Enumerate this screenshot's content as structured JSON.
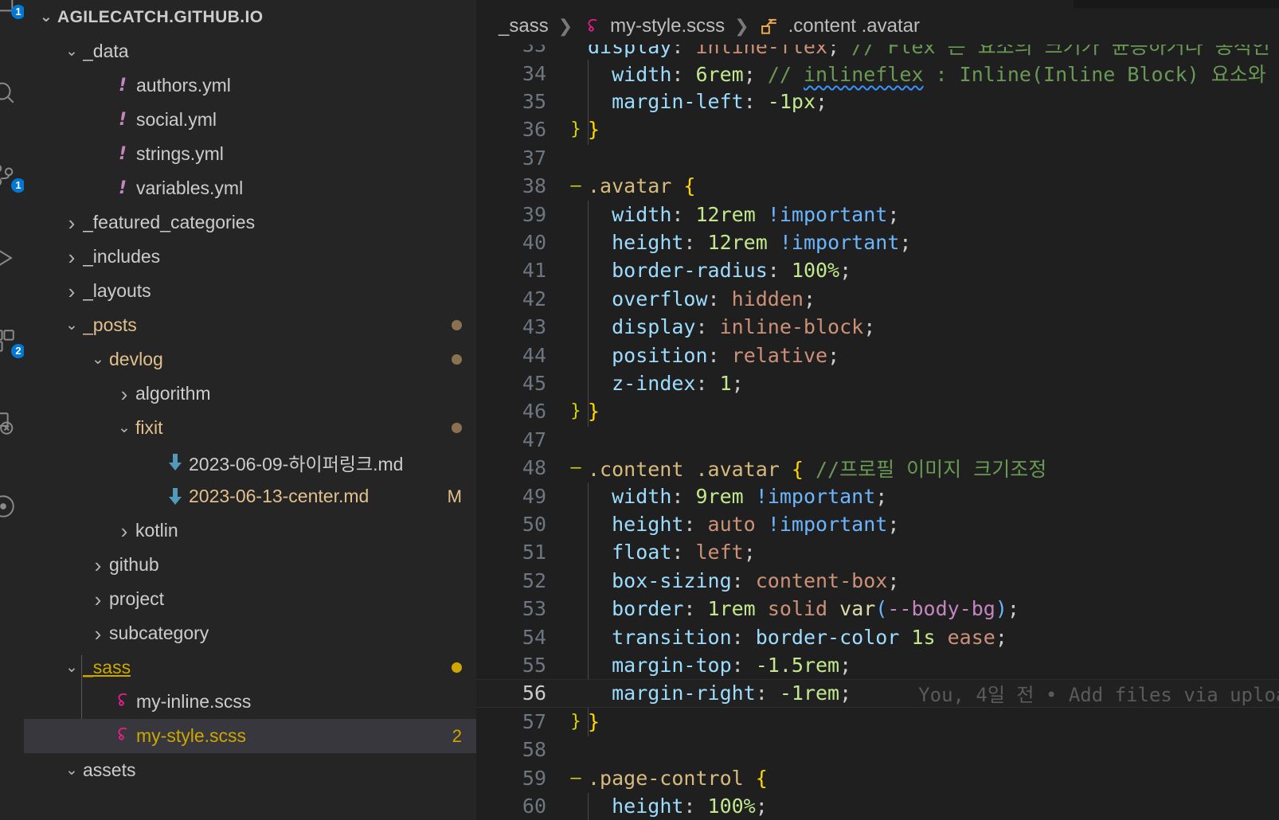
{
  "activity_bar": {
    "items": [
      {
        "name": "explorer-icon",
        "badge": "1"
      },
      {
        "name": "search-icon",
        "badge": null
      },
      {
        "name": "source-control-icon",
        "badge": "1"
      },
      {
        "name": "run-and-debug-icon",
        "badge": null
      },
      {
        "name": "extensions-icon",
        "badge": "2"
      },
      {
        "name": "remote-explorer-icon",
        "badge": null
      },
      {
        "name": "testing-icon",
        "badge": null
      }
    ]
  },
  "explorer": {
    "root_label": "AGILECATCH.GITHUB.IO",
    "tree": [
      {
        "label": "_data",
        "kind": "folder",
        "depth": 1,
        "expanded": true
      },
      {
        "label": "authors.yml",
        "kind": "yml",
        "depth": 2
      },
      {
        "label": "social.yml",
        "kind": "yml",
        "depth": 2
      },
      {
        "label": "strings.yml",
        "kind": "yml",
        "depth": 2
      },
      {
        "label": "variables.yml",
        "kind": "yml",
        "depth": 2
      },
      {
        "label": "_featured_categories",
        "kind": "folder",
        "depth": 1,
        "expanded": false
      },
      {
        "label": "_includes",
        "kind": "folder",
        "depth": 1,
        "expanded": false
      },
      {
        "label": "_layouts",
        "kind": "folder",
        "depth": 1,
        "expanded": false
      },
      {
        "label": "_posts",
        "kind": "folder",
        "depth": 1,
        "expanded": true,
        "git_status": "modified-child",
        "dot": true
      },
      {
        "label": "devlog",
        "kind": "folder",
        "depth": 2,
        "expanded": true,
        "git_status": "modified-child",
        "dot": true
      },
      {
        "label": "algorithm",
        "kind": "folder",
        "depth": 3,
        "expanded": false
      },
      {
        "label": "fixit",
        "kind": "folder",
        "depth": 3,
        "expanded": true,
        "git_status": "modified-child",
        "dot": true
      },
      {
        "label": "2023-06-09-하이퍼링크.md",
        "kind": "md",
        "depth": 4
      },
      {
        "label": "2023-06-13-center.md",
        "kind": "md",
        "depth": 4,
        "git_status": "modified",
        "badge": "M"
      },
      {
        "label": "kotlin",
        "kind": "folder",
        "depth": 3,
        "expanded": false
      },
      {
        "label": "github",
        "kind": "folder",
        "depth": 2,
        "expanded": false
      },
      {
        "label": "project",
        "kind": "folder",
        "depth": 2,
        "expanded": false
      },
      {
        "label": "subcategory",
        "kind": "folder",
        "depth": 2,
        "expanded": false
      },
      {
        "label": "_sass",
        "kind": "folder",
        "depth": 1,
        "expanded": true,
        "git_status": "modified-child-strong",
        "dot": true
      },
      {
        "label": "my-inline.scss",
        "kind": "scss",
        "depth": 2
      },
      {
        "label": "my-style.scss",
        "kind": "scss",
        "depth": 2,
        "selected": true,
        "git_status": "problems",
        "badge": "2"
      },
      {
        "label": "assets",
        "kind": "folder",
        "depth": 1,
        "expanded": true
      }
    ]
  },
  "breadcrumb": {
    "folder": "_sass",
    "file": "my-style.scss",
    "symbol": ".content .avatar",
    "separator": "❯"
  },
  "editor": {
    "active_line": 56,
    "blame": "You, 4일 전 • Add files via uploa",
    "lines": [
      {
        "n": 33,
        "clipped_top": true,
        "fold": "",
        "tokens": [
          {
            "t": "display",
            "c": "t-prop"
          },
          {
            "t": ": ",
            "c": "t-punc"
          },
          {
            "t": "inline-flex",
            "c": "t-val"
          },
          {
            "t": ";",
            "c": "t-punc"
          },
          {
            "t": " // Flex 은 요소의 크기가 균등하거나 동적인",
            "c": "t-com"
          }
        ]
      },
      {
        "n": 34,
        "fold": "",
        "tokens": [
          {
            "t": "  ",
            "c": "t-punc"
          },
          {
            "t": "width",
            "c": "t-prop"
          },
          {
            "t": ": ",
            "c": "t-punc"
          },
          {
            "t": "6rem",
            "c": "t-num"
          },
          {
            "t": ";",
            "c": "t-punc"
          },
          {
            "t": " // ",
            "c": "t-com"
          },
          {
            "t": "inlineflex",
            "c": "t-com squiggle"
          },
          {
            "t": " : Inline(Inline Block) 요소와 같은",
            "c": "t-com"
          }
        ]
      },
      {
        "n": 35,
        "fold": "",
        "tokens": [
          {
            "t": "  ",
            "c": "t-punc"
          },
          {
            "t": "margin-left",
            "c": "t-prop"
          },
          {
            "t": ": ",
            "c": "t-punc"
          },
          {
            "t": "-1px",
            "c": "t-num"
          },
          {
            "t": ";",
            "c": "t-punc"
          }
        ]
      },
      {
        "n": 36,
        "fold": "}",
        "tokens": [
          {
            "t": "}",
            "c": "t-brace"
          }
        ]
      },
      {
        "n": 37,
        "fold": "",
        "tokens": []
      },
      {
        "n": 38,
        "fold": "-",
        "tokens": [
          {
            "t": ".avatar",
            "c": "t-sel"
          },
          {
            "t": " ",
            "c": "t-punc"
          },
          {
            "t": "{",
            "c": "t-brace"
          }
        ]
      },
      {
        "n": 39,
        "fold": "",
        "tokens": [
          {
            "t": "  ",
            "c": "t-punc"
          },
          {
            "t": "width",
            "c": "t-prop"
          },
          {
            "t": ": ",
            "c": "t-punc"
          },
          {
            "t": "12rem",
            "c": "t-num"
          },
          {
            "t": " ",
            "c": "t-punc"
          },
          {
            "t": "!important",
            "c": "t-kw"
          },
          {
            "t": ";",
            "c": "t-punc"
          }
        ]
      },
      {
        "n": 40,
        "fold": "",
        "tokens": [
          {
            "t": "  ",
            "c": "t-punc"
          },
          {
            "t": "height",
            "c": "t-prop"
          },
          {
            "t": ": ",
            "c": "t-punc"
          },
          {
            "t": "12rem",
            "c": "t-num"
          },
          {
            "t": " ",
            "c": "t-punc"
          },
          {
            "t": "!important",
            "c": "t-kw"
          },
          {
            "t": ";",
            "c": "t-punc"
          }
        ]
      },
      {
        "n": 41,
        "fold": "",
        "tokens": [
          {
            "t": "  ",
            "c": "t-punc"
          },
          {
            "t": "border-radius",
            "c": "t-prop"
          },
          {
            "t": ": ",
            "c": "t-punc"
          },
          {
            "t": "100%",
            "c": "t-num"
          },
          {
            "t": ";",
            "c": "t-punc"
          }
        ]
      },
      {
        "n": 42,
        "fold": "",
        "tokens": [
          {
            "t": "  ",
            "c": "t-punc"
          },
          {
            "t": "overflow",
            "c": "t-prop"
          },
          {
            "t": ": ",
            "c": "t-punc"
          },
          {
            "t": "hidden",
            "c": "t-val"
          },
          {
            "t": ";",
            "c": "t-punc"
          }
        ]
      },
      {
        "n": 43,
        "fold": "",
        "tokens": [
          {
            "t": "  ",
            "c": "t-punc"
          },
          {
            "t": "display",
            "c": "t-prop"
          },
          {
            "t": ": ",
            "c": "t-punc"
          },
          {
            "t": "inline-block",
            "c": "t-val"
          },
          {
            "t": ";",
            "c": "t-punc"
          }
        ]
      },
      {
        "n": 44,
        "fold": "",
        "tokens": [
          {
            "t": "  ",
            "c": "t-punc"
          },
          {
            "t": "position",
            "c": "t-prop"
          },
          {
            "t": ": ",
            "c": "t-punc"
          },
          {
            "t": "relative",
            "c": "t-val"
          },
          {
            "t": ";",
            "c": "t-punc"
          }
        ]
      },
      {
        "n": 45,
        "fold": "",
        "tokens": [
          {
            "t": "  ",
            "c": "t-punc"
          },
          {
            "t": "z-index",
            "c": "t-prop"
          },
          {
            "t": ": ",
            "c": "t-punc"
          },
          {
            "t": "1",
            "c": "t-num"
          },
          {
            "t": ";",
            "c": "t-punc"
          }
        ]
      },
      {
        "n": 46,
        "fold": "}",
        "tokens": [
          {
            "t": "}",
            "c": "t-brace"
          }
        ]
      },
      {
        "n": 47,
        "fold": "",
        "tokens": []
      },
      {
        "n": 48,
        "fold": "-",
        "tokens": [
          {
            "t": ".content .avatar",
            "c": "t-sel"
          },
          {
            "t": " ",
            "c": "t-punc"
          },
          {
            "t": "{",
            "c": "t-brace"
          },
          {
            "t": " //프로필 이미지 크기조정",
            "c": "t-com"
          }
        ]
      },
      {
        "n": 49,
        "fold": "",
        "tokens": [
          {
            "t": "  ",
            "c": "t-punc"
          },
          {
            "t": "width",
            "c": "t-prop"
          },
          {
            "t": ": ",
            "c": "t-punc"
          },
          {
            "t": "9rem",
            "c": "t-num"
          },
          {
            "t": " ",
            "c": "t-punc"
          },
          {
            "t": "!important",
            "c": "t-kw"
          },
          {
            "t": ";",
            "c": "t-punc"
          }
        ]
      },
      {
        "n": 50,
        "fold": "",
        "tokens": [
          {
            "t": "  ",
            "c": "t-punc"
          },
          {
            "t": "height",
            "c": "t-prop"
          },
          {
            "t": ": ",
            "c": "t-punc"
          },
          {
            "t": "auto",
            "c": "t-val"
          },
          {
            "t": " ",
            "c": "t-punc"
          },
          {
            "t": "!important",
            "c": "t-kw"
          },
          {
            "t": ";",
            "c": "t-punc"
          }
        ]
      },
      {
        "n": 51,
        "fold": "",
        "tokens": [
          {
            "t": "  ",
            "c": "t-punc"
          },
          {
            "t": "float",
            "c": "t-prop"
          },
          {
            "t": ": ",
            "c": "t-punc"
          },
          {
            "t": "left",
            "c": "t-val"
          },
          {
            "t": ";",
            "c": "t-punc"
          }
        ]
      },
      {
        "n": 52,
        "fold": "",
        "tokens": [
          {
            "t": "  ",
            "c": "t-punc"
          },
          {
            "t": "box-sizing",
            "c": "t-prop"
          },
          {
            "t": ": ",
            "c": "t-punc"
          },
          {
            "t": "content-box",
            "c": "t-val"
          },
          {
            "t": ";",
            "c": "t-punc"
          }
        ]
      },
      {
        "n": 53,
        "fold": "",
        "tokens": [
          {
            "t": "  ",
            "c": "t-punc"
          },
          {
            "t": "border",
            "c": "t-prop"
          },
          {
            "t": ": ",
            "c": "t-punc"
          },
          {
            "t": "1rem",
            "c": "t-num"
          },
          {
            "t": " ",
            "c": "t-punc"
          },
          {
            "t": "solid",
            "c": "t-val"
          },
          {
            "t": " ",
            "c": "t-punc"
          },
          {
            "t": "var",
            "c": "t-varfn"
          },
          {
            "t": "(",
            "c": "t-paren"
          },
          {
            "t": "--body-bg",
            "c": "t-dash"
          },
          {
            "t": ")",
            "c": "t-paren"
          },
          {
            "t": ";",
            "c": "t-punc"
          }
        ]
      },
      {
        "n": 54,
        "fold": "",
        "tokens": [
          {
            "t": "  ",
            "c": "t-punc"
          },
          {
            "t": "transition",
            "c": "t-prop"
          },
          {
            "t": ": ",
            "c": "t-punc"
          },
          {
            "t": "border-color",
            "c": "t-prop"
          },
          {
            "t": " ",
            "c": "t-punc"
          },
          {
            "t": "1s",
            "c": "t-num"
          },
          {
            "t": " ",
            "c": "t-punc"
          },
          {
            "t": "ease",
            "c": "t-val"
          },
          {
            "t": ";",
            "c": "t-punc"
          }
        ]
      },
      {
        "n": 55,
        "fold": "",
        "tokens": [
          {
            "t": "  ",
            "c": "t-punc"
          },
          {
            "t": "margin-top",
            "c": "t-prop"
          },
          {
            "t": ": ",
            "c": "t-punc"
          },
          {
            "t": "-1.5rem",
            "c": "t-num"
          },
          {
            "t": ";",
            "c": "t-punc"
          }
        ]
      },
      {
        "n": 56,
        "fold": "",
        "active": true,
        "tokens": [
          {
            "t": "  ",
            "c": "t-punc"
          },
          {
            "t": "margin-right",
            "c": "t-prop"
          },
          {
            "t": ": ",
            "c": "t-punc"
          },
          {
            "t": "-1rem",
            "c": "t-num"
          },
          {
            "t": ";",
            "c": "t-punc"
          }
        ]
      },
      {
        "n": 57,
        "fold": "}",
        "tokens": [
          {
            "t": "}",
            "c": "t-brace"
          }
        ]
      },
      {
        "n": 58,
        "fold": "",
        "tokens": []
      },
      {
        "n": 59,
        "fold": "-",
        "tokens": [
          {
            "t": ".page-control",
            "c": "t-sel"
          },
          {
            "t": " ",
            "c": "t-punc"
          },
          {
            "t": "{",
            "c": "t-brace"
          }
        ]
      },
      {
        "n": 60,
        "fold": "",
        "clipped_bottom": true,
        "tokens": [
          {
            "t": "  ",
            "c": "t-punc"
          },
          {
            "t": "height",
            "c": "t-prop"
          },
          {
            "t": ": ",
            "c": "t-punc"
          },
          {
            "t": "100%",
            "c": "t-num"
          },
          {
            "t": ";",
            "c": "t-punc"
          }
        ]
      }
    ]
  },
  "colors": {
    "sidebar_bg": "#252526",
    "editor_bg": "#1f1f1f",
    "activity_bg": "#252526",
    "selection_bg": "#37373d",
    "badge_blue": "#0078d4",
    "git_modified": "#e2c08d",
    "git_modified_folder": "#8a7250",
    "problem_yellow": "#cca700",
    "scss_pink": "#e91e8c",
    "yml_purple": "#c586c0",
    "md_blue": "#519aba"
  }
}
